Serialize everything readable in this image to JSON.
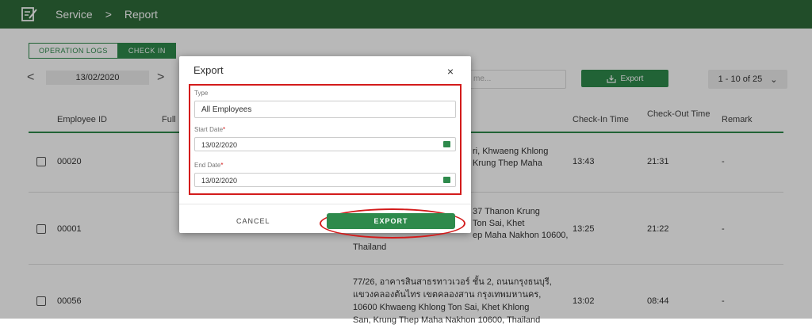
{
  "header": {
    "section": "Service",
    "separator": ">",
    "page": "Report"
  },
  "tabs": [
    {
      "label": "OPERATION LOGS"
    },
    {
      "label": "CHECK IN"
    }
  ],
  "date_nav": {
    "prev": "<",
    "date": "13/02/2020",
    "next": ">"
  },
  "search": {
    "placeholder": "me..."
  },
  "toolbar": {
    "export_label": "Export"
  },
  "pager": {
    "label": "1 - 10 of 25",
    "chevron": "⌄"
  },
  "table": {
    "columns": [
      "Employee ID",
      "Full",
      "Check-In Time",
      "Check-Out Time",
      "Remark"
    ],
    "rows": [
      {
        "id": "00020",
        "address_lines": [
          "ri, Khwaeng Khlong",
          "Krung Thep Maha"
        ],
        "check_in": "13:43",
        "check_out": "21:31",
        "remark": "-"
      },
      {
        "id": "00001",
        "address_lines": [
          "37 Thanon Krung",
          "Ton Sai, Khet",
          "ep Maha Nakhon 10600,",
          "Thailand"
        ],
        "check_in": "13:25",
        "check_out": "21:22",
        "remark": "-"
      },
      {
        "id": "00056",
        "address_lines": [
          "77/26, อาคารสินสาธรทาวเวอร์ ชั้น 2, ถนนกรุงธนบุรี,",
          "แขวงคลองต้นไทร เขตคลองสาน กรุงเทพมหานคร,",
          "10600 Khwaeng Khlong Ton Sai, Khet Khlong",
          "San, Krung Thep Maha Nakhon 10600, Thailand"
        ],
        "check_in": "13:02",
        "check_out": "08:44",
        "remark": "-"
      }
    ]
  },
  "modal": {
    "title": "Export",
    "close": "×",
    "type_label": "Type",
    "type_value": "All Employees",
    "start_label": "Start Date",
    "start_value": "13/02/2020",
    "end_label": "End Date",
    "end_value": "13/02/2020",
    "required_mark": "*",
    "cancel": "CANCEL",
    "export": "EXPORT"
  },
  "colors": {
    "primary": "#2e8a4c",
    "header": "#2e6b3a",
    "highlight": "#d31b1b"
  }
}
